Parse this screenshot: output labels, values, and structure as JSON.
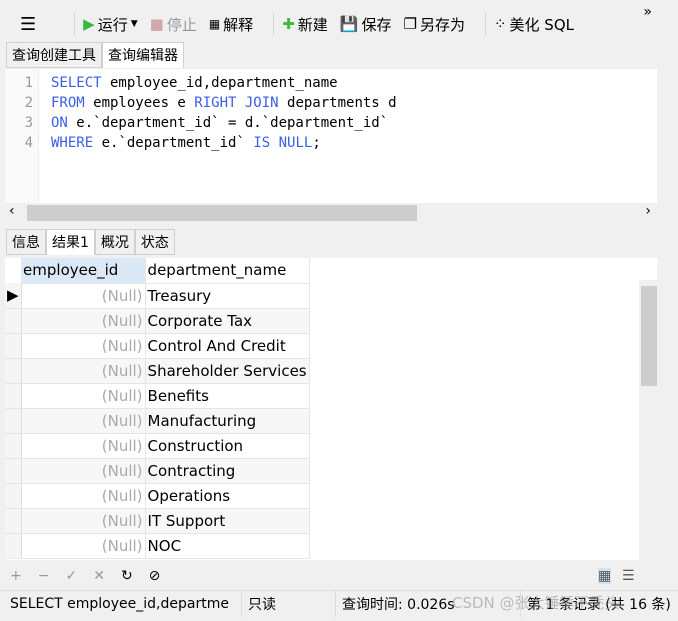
{
  "toolbar": {
    "run": "运行",
    "stop": "停止",
    "explain": "解释",
    "new": "新建",
    "save": "保存",
    "save_as": "另存为",
    "beautify": "美化 SQL",
    "more": "»"
  },
  "editor_tabs": [
    "查询创建工具",
    "查询编辑器"
  ],
  "sql_lines": [
    [
      [
        "kw",
        "SELECT"
      ],
      [
        "t",
        " employee_id,department_name"
      ]
    ],
    [
      [
        "kw",
        "FROM"
      ],
      [
        "t",
        " employees e "
      ],
      [
        "kw",
        "RIGHT JOIN"
      ],
      [
        "t",
        " departments d"
      ]
    ],
    [
      [
        "kw",
        "ON"
      ],
      [
        "t",
        " e.`department_id` = d.`department_id`"
      ]
    ],
    [
      [
        "kw",
        "WHERE"
      ],
      [
        "t",
        " e.`department_id` "
      ],
      [
        "kw",
        "IS NULL"
      ],
      [
        "t",
        ";"
      ]
    ]
  ],
  "result_tabs": [
    "信息",
    "结果1",
    "概况",
    "状态"
  ],
  "columns": [
    "employee_id",
    "department_name"
  ],
  "rows": [
    [
      "(Null)",
      "Treasury"
    ],
    [
      "(Null)",
      "Corporate Tax"
    ],
    [
      "(Null)",
      "Control And Credit"
    ],
    [
      "(Null)",
      "Shareholder Services"
    ],
    [
      "(Null)",
      "Benefits"
    ],
    [
      "(Null)",
      "Manufacturing"
    ],
    [
      "(Null)",
      "Construction"
    ],
    [
      "(Null)",
      "Contracting"
    ],
    [
      "(Null)",
      "Operations"
    ],
    [
      "(Null)",
      "IT Support"
    ],
    [
      "(Null)",
      "NOC"
    ]
  ],
  "status": {
    "sql": "SELECT employee_id,departme",
    "mode": "只读",
    "time": "查询时间: 0.026s",
    "record": "第 1 条记录 (共 16 条)"
  },
  "watermark": "CSDN @张大锤锤不秃头",
  "colors": {
    "keyword": "#3c5de8",
    "run": "#3cb83c"
  }
}
